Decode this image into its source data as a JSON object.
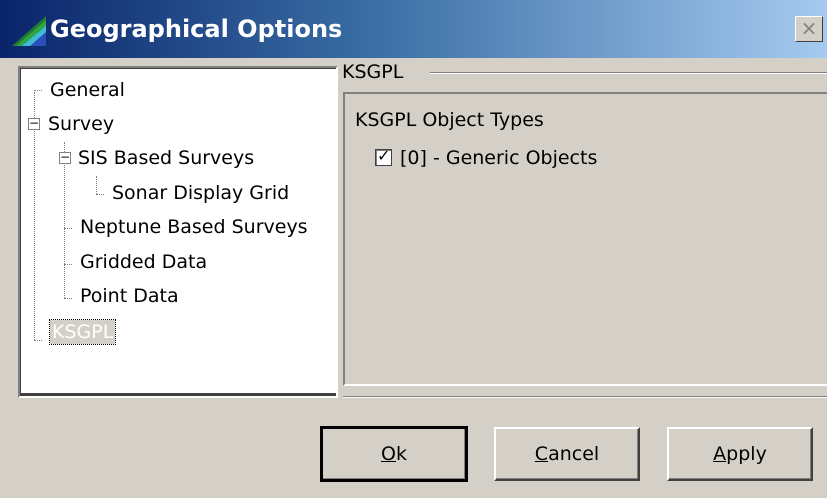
{
  "window": {
    "title": "Geographical Options",
    "close_glyph": "×"
  },
  "tree": {
    "items": [
      {
        "label": "General"
      },
      {
        "label": "Survey",
        "expander": "−"
      },
      {
        "label": "SIS Based Surveys",
        "expander": "−"
      },
      {
        "label": "Sonar Display Grid"
      },
      {
        "label": "Neptune Based Surveys"
      },
      {
        "label": "Gridded Data"
      },
      {
        "label": "Point Data"
      },
      {
        "label": "KSGPL",
        "selected": true
      }
    ]
  },
  "group": {
    "label": "KSGPL",
    "heading": "KSGPL Object Types",
    "checkbox": {
      "label": "[0] - Generic Objects",
      "checked": true,
      "mark": "✓"
    }
  },
  "buttons": {
    "ok": {
      "mnemonic": "O",
      "rest": "k"
    },
    "cancel": {
      "mnemonic": "C",
      "rest": "ancel"
    },
    "apply": {
      "mnemonic": "A",
      "rest": "pply"
    }
  },
  "colors": {
    "face": "#d4d0c8",
    "title_start": "#0a246a",
    "title_end": "#a6caf0"
  }
}
